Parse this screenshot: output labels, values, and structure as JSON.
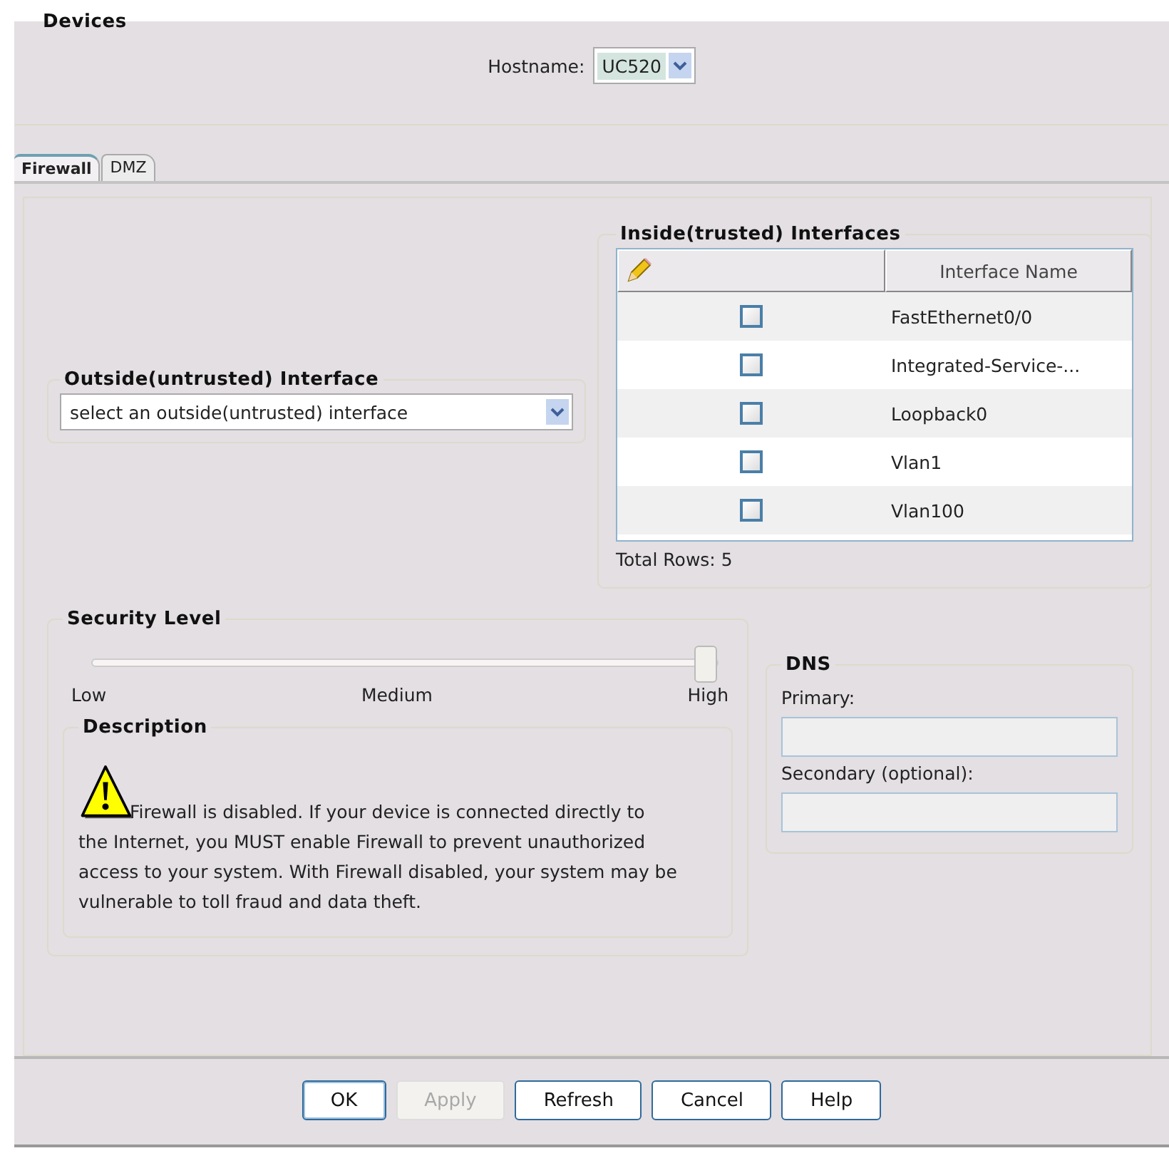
{
  "devices": {
    "title": "Devices",
    "hostname_label": "Hostname:",
    "hostname_value": "UC520"
  },
  "tabs": [
    {
      "label": "Firewall",
      "selected": true
    },
    {
      "label": "DMZ",
      "selected": false
    }
  ],
  "outside": {
    "title": "Outside(untrusted) Interface",
    "value": "select an outside(untrusted) interface"
  },
  "inside": {
    "title": "Inside(trusted) Interfaces",
    "columns": [
      "Interface Name"
    ],
    "rows": [
      {
        "checked": false,
        "name": "FastEthernet0/0"
      },
      {
        "checked": false,
        "name": "Integrated-Service-..."
      },
      {
        "checked": false,
        "name": "Loopback0"
      },
      {
        "checked": false,
        "name": "Vlan1"
      },
      {
        "checked": false,
        "name": "Vlan100"
      }
    ],
    "total": "Total Rows: 5"
  },
  "security": {
    "title": "Security Level",
    "level": 1,
    "labels": [
      "Low",
      "Medium",
      "High"
    ],
    "description_title": "Description",
    "description": "Firewall is disabled. If your device is connected directly to the Internet, you MUST enable Firewall to prevent unauthorized access to your system. With Firewall disabled, your system may be vulnerable to toll fraud and data theft."
  },
  "dns": {
    "title": "DNS",
    "fields": [
      {
        "label": "Primary:"
      },
      {
        "label": "Secondary (optional):"
      }
    ]
  },
  "buttons": [
    {
      "label": "OK",
      "disabled": false,
      "default": true
    },
    {
      "label": "Apply",
      "disabled": true,
      "default": false
    },
    {
      "label": "Refresh",
      "disabled": false,
      "default": false
    },
    {
      "label": "Cancel",
      "disabled": false,
      "default": false
    },
    {
      "label": "Help",
      "disabled": false,
      "default": false
    }
  ]
}
